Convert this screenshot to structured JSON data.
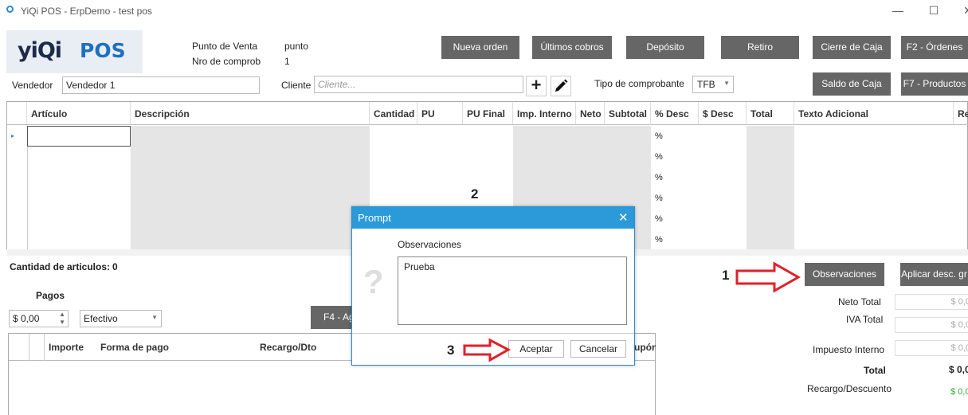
{
  "window": {
    "title": "YiQi POS - ErpDemo - test pos",
    "minimize": "—",
    "maximize": "☐",
    "close": "✕"
  },
  "logo": {
    "yiqi": "yiQi",
    "pos": "POS"
  },
  "info": {
    "punto_label": "Punto de Venta",
    "punto_value": "punto",
    "nro_label": "Nro de comprob",
    "nro_value": "1"
  },
  "vendedor": {
    "label": "Vendedor",
    "value": "Vendedor 1"
  },
  "cliente": {
    "label": "Cliente",
    "placeholder": "Cliente..."
  },
  "tipo": {
    "label": "Tipo de comprobante",
    "value": "TFB"
  },
  "buttons": {
    "nueva_orden": "Nueva orden",
    "ultimos_cobros": "Últimos cobros",
    "deposito": "Depósito",
    "retiro": "Retiro",
    "cierre_caja": "Cierre de Caja",
    "f2_ordenes": "F2 - Órdenes",
    "saldo_caja": "Saldo de Caja",
    "f7_productos": "F7 - Productos",
    "observaciones": "Observaciones",
    "aplicar_desc": "Aplicar desc. gr",
    "f4": "F4 - Ag"
  },
  "grid": {
    "columns": [
      "Artículo",
      "Descripción",
      "Cantidad",
      "PU",
      "PU Final",
      "Imp. Interno",
      "Neto",
      "Subtotal",
      "% Desc",
      "$ Desc",
      "Total",
      "Texto Adicional",
      "Re"
    ],
    "pct_symbol": "%"
  },
  "cantidad": {
    "label": "Cantidad de articulos:",
    "value": "0"
  },
  "pagos": {
    "title": "Pagos",
    "amount": "$ 0,00",
    "method": "Efectivo",
    "columns": [
      "Importe",
      "Forma de pago",
      "Recargo/Dto",
      "upón"
    ]
  },
  "totals": {
    "neto_label": "Neto Total",
    "neto_value": "$ 0,0",
    "iva_label": "IVA Total",
    "iva_value": "$ 0,0",
    "imp_label": "Impuesto Interno",
    "imp_value": "$ 0,0",
    "total_label": "Total",
    "total_value": "$ 0,0",
    "recargo_label": "Recargo/Descuento",
    "recargo_value": "$ 0,0"
  },
  "dialog": {
    "title": "Prompt",
    "label": "Observaciones",
    "text": "Prueba",
    "ok": "Aceptar",
    "cancel": "Cancelar",
    "icon": "?"
  },
  "annotations": {
    "n1": "1",
    "n2": "2",
    "n3": "3"
  },
  "colors": {
    "accent": "#2a9ad8",
    "button": "#666666",
    "arrow": "#e0202a",
    "green": "#2eaa2e"
  }
}
